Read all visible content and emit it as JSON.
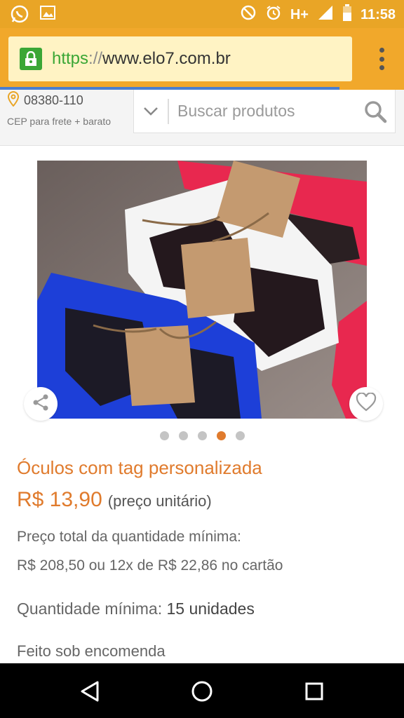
{
  "status_bar": {
    "network": "H+",
    "time": "11:58",
    "icons": [
      "whatsapp-icon",
      "gallery-icon",
      "do-not-disturb-icon",
      "alarm-icon",
      "signal-icon",
      "battery-icon"
    ]
  },
  "browser": {
    "url_scheme": "https",
    "url_separator": "://",
    "url_host": "www.elo7.com.br",
    "colors": {
      "toolbar": "#f1a82b",
      "status_bar": "#e9a526",
      "url_bg": "#fff3c4",
      "lock": "#3aa635",
      "progress": "#4a7ed0"
    },
    "load_progress": 0.84
  },
  "header": {
    "cep_code": "08380-110",
    "cep_subtitle": "CEP para frete + barato",
    "search_placeholder": "Buscar produtos"
  },
  "carousel": {
    "dots_count": 5,
    "active_index": 3,
    "accent": "#e07b2d"
  },
  "product": {
    "title": "Óculos com tag personalizada",
    "price": "R$ 13,90",
    "price_note": "(preço unitário)",
    "total_label": "Preço total da quantidade mínima:",
    "total_value": "R$ 208,50 ou 12x de R$ 22,86 no cartão",
    "min_qty_label": "Quantidade mínima:",
    "min_qty_value": "15 unidades",
    "made_to_order": "Feito sob encomenda"
  },
  "navbar": {
    "buttons": [
      "back-icon",
      "home-icon",
      "recents-icon"
    ]
  }
}
